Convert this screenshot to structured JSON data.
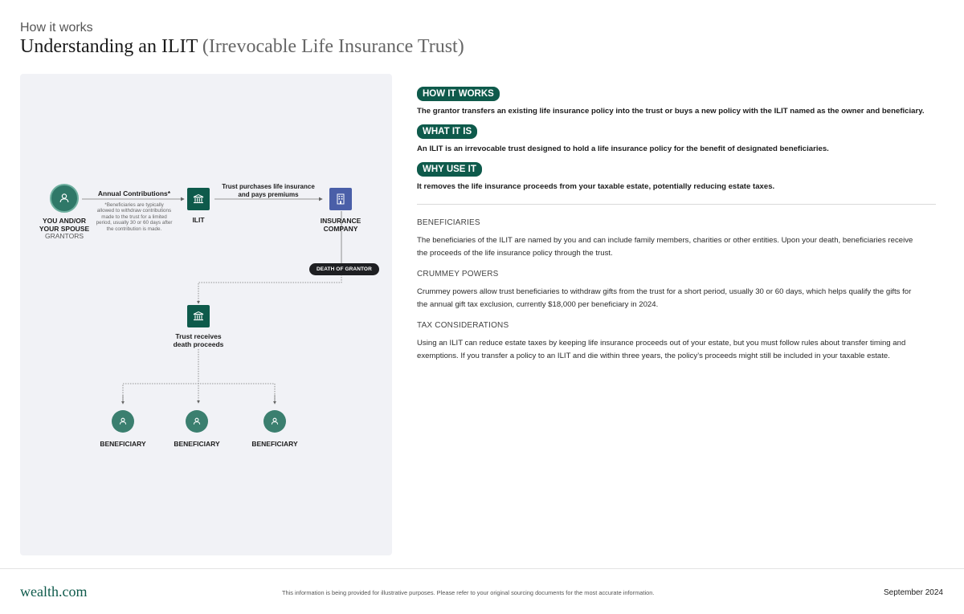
{
  "header": {
    "eyebrow": "How it works",
    "title_main": "Understanding an ILIT",
    "title_sub": "(Irrevocable Life Insurance Trust)"
  },
  "diagram": {
    "grantor_label_1": "YOU AND/OR",
    "grantor_label_2": "YOUR SPOUSE",
    "grantor_sublabel": "GRANTORS",
    "contributions_label": "Annual Contributions*",
    "contributions_note_lines": [
      "*Beneficiaries are typically",
      "allowed to withdraw contributions",
      "made to the trust for a limited",
      "period, usually 30 or 60 days after",
      "the contribution is made."
    ],
    "ilit_label": "ILIT",
    "purchase_label_1": "Trust purchases life insurance",
    "purchase_label_2": "and pays premiums",
    "insurer_label_1": "INSURANCE",
    "insurer_label_2": "COMPANY",
    "death_pill": "DEATH OF GRANTOR",
    "receives_label_1": "Trust receives",
    "receives_label_2": "death proceeds",
    "beneficiaries": [
      "BENEFICIARY",
      "BENEFICIARY",
      "BENEFICIARY"
    ]
  },
  "info": {
    "how_badge": "HOW IT WORKS",
    "how_text": "The grantor transfers an existing life insurance policy into the trust or buys a new policy with the ILIT named as the owner and beneficiary.",
    "what_badge": "WHAT IT IS",
    "what_text": "An ILIT is an irrevocable trust designed to hold a life insurance policy for the benefit of designated beneficiaries.",
    "why_badge": "WHY USE IT",
    "why_text": "It removes the life insurance proceeds from your taxable estate, potentially reducing estate taxes."
  },
  "sections": {
    "beneficiaries_head": "BENEFICIARIES",
    "beneficiaries_line1": "The beneficiaries of the ILIT are named by you and can include family members, charities or other entities. Upon your death, beneficiaries receive",
    "beneficiaries_line2": "the proceeds of the life insurance policy through the trust.",
    "crummey_head": "CRUMMEY POWERS",
    "crummey_line1": "Crummey powers allow trust beneficiaries to withdraw gifts from the trust for a short period, usually 30 or 60 days, which helps qualify the gifts for",
    "crummey_line2": "the annual gift tax exclusion, currently $18,000 per beneficiary in 2024.",
    "tax_head": "TAX CONSIDERATIONS",
    "tax_line1": "Using an ILIT can reduce estate taxes by keeping life insurance proceeds out of your estate, but you must follow rules about transfer timing and",
    "tax_line2": "exemptions. If you transfer a policy to an ILIT and die within three years, the policy’s proceeds might still be included in your taxable estate."
  },
  "footer": {
    "logo": "wealth.com",
    "disclaimer": "This information is being provided for illustrative purposes. Please refer to your original sourcing documents for the most accurate information.",
    "date": "September 2024"
  },
  "colors": {
    "brand_green": "#0e5a4b",
    "person_green": "#3b7f6f",
    "insurer_blue": "#4a5fa8",
    "panel_bg": "#f1f2f6",
    "pill_dark": "#1e1f22"
  },
  "icons": {
    "person": "person-icon",
    "trust": "bank-icon",
    "insurer": "building-icon"
  }
}
